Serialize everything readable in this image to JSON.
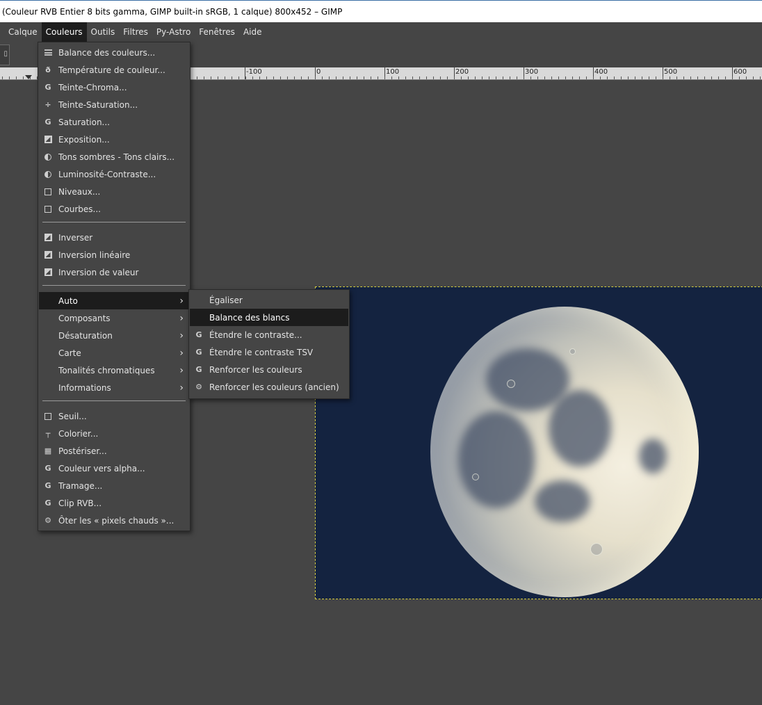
{
  "window": {
    "title": "(Couleur RVB Entier 8 bits gamma, GIMP built-in sRGB, 1 calque) 800x452 – GIMP"
  },
  "menubar": [
    {
      "label": "Calque"
    },
    {
      "label": "Couleurs",
      "active": true
    },
    {
      "label": "Outils"
    },
    {
      "label": "Filtres"
    },
    {
      "label": "Py-Astro"
    },
    {
      "label": "Fenêtres"
    },
    {
      "label": "Aide"
    }
  ],
  "ruler": {
    "labels": [
      "-100",
      "0",
      "100",
      "200",
      "300",
      "400",
      "500",
      "600"
    ]
  },
  "couleurs_menu": {
    "group1": [
      {
        "label": "Balance des couleurs...",
        "icon": "balance-icon"
      },
      {
        "label": "Température de couleur...",
        "icon": "thermometer-icon"
      },
      {
        "label": "Teinte-Chroma...",
        "icon": "gegl-icon"
      },
      {
        "label": "Teinte-Saturation...",
        "icon": "hue-saturation-icon"
      },
      {
        "label": "Saturation...",
        "icon": "gegl-icon"
      },
      {
        "label": "Exposition...",
        "icon": "exposure-icon"
      },
      {
        "label": "Tons sombres - Tons clairs...",
        "icon": "shadows-highlights-icon"
      },
      {
        "label": "Luminosité-Contraste...",
        "icon": "brightness-contrast-icon"
      },
      {
        "label": "Niveaux...",
        "icon": "levels-icon"
      },
      {
        "label": "Courbes...",
        "icon": "curves-icon"
      }
    ],
    "group2": [
      {
        "label": "Inverser",
        "icon": "invert-icon"
      },
      {
        "label": "Inversion linéaire",
        "icon": "invert-icon"
      },
      {
        "label": "Inversion de valeur",
        "icon": "invert-icon"
      }
    ],
    "group3": [
      {
        "label": "Auto",
        "submenu": true,
        "selected": true
      },
      {
        "label": "Composants",
        "submenu": true
      },
      {
        "label": "Désaturation",
        "submenu": true
      },
      {
        "label": "Carte",
        "submenu": true
      },
      {
        "label": "Tonalités chromatiques",
        "submenu": true
      },
      {
        "label": "Informations",
        "submenu": true
      }
    ],
    "group4": [
      {
        "label": "Seuil...",
        "icon": "threshold-icon"
      },
      {
        "label": "Colorier...",
        "icon": "colorize-icon"
      },
      {
        "label": "Postériser...",
        "icon": "posterize-icon"
      },
      {
        "label": "Couleur vers alpha...",
        "icon": "gegl-icon"
      },
      {
        "label": "Tramage...",
        "icon": "gegl-icon"
      },
      {
        "label": "Clip RVB...",
        "icon": "gegl-icon"
      },
      {
        "label": "Ôter les « pixels chauds »...",
        "icon": "plugin-icon"
      }
    ]
  },
  "auto_submenu": [
    {
      "label": "Égaliser",
      "icon": ""
    },
    {
      "label": "Balance des blancs",
      "icon": "",
      "selected": true
    },
    {
      "label": "Étendre le contraste...",
      "icon": "gegl-icon"
    },
    {
      "label": "Étendre le contraste TSV",
      "icon": "gegl-icon"
    },
    {
      "label": "Renforcer les couleurs",
      "icon": "gegl-icon"
    },
    {
      "label": "Renforcer les couleurs (ancien)",
      "icon": "plugin-icon"
    }
  ],
  "colors": {
    "menu_bg": "#454545",
    "selected_bg": "#1c1c1c",
    "canvas_bg": "#142340"
  }
}
